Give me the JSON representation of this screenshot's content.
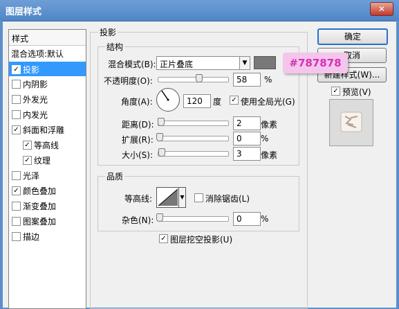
{
  "window": {
    "title": "图层样式",
    "close_glyph": "✕"
  },
  "colors": {
    "shadow_swatch": "#787878",
    "tooltip_text": "#787878"
  },
  "sidebar": {
    "header": "样式",
    "items": [
      {
        "label": "混合选项:默认",
        "checkbox": false
      },
      {
        "label": "投影",
        "checkbox": true,
        "checked": true,
        "selected": true
      },
      {
        "label": "内阴影",
        "checkbox": true,
        "checked": false
      },
      {
        "label": "外发光",
        "checkbox": true,
        "checked": false
      },
      {
        "label": "内发光",
        "checkbox": true,
        "checked": false
      },
      {
        "label": "斜面和浮雕",
        "checkbox": true,
        "checked": true
      },
      {
        "label": "等高线",
        "checkbox": true,
        "checked": true,
        "indent": true
      },
      {
        "label": "纹理",
        "checkbox": true,
        "checked": true,
        "indent": true
      },
      {
        "label": "光泽",
        "checkbox": true,
        "checked": false
      },
      {
        "label": "颜色叠加",
        "checkbox": true,
        "checked": true
      },
      {
        "label": "渐变叠加",
        "checkbox": true,
        "checked": false
      },
      {
        "label": "图案叠加",
        "checkbox": true,
        "checked": false
      },
      {
        "label": "描边",
        "checkbox": true,
        "checked": false
      }
    ]
  },
  "drop_shadow": {
    "section_title": "投影",
    "structure_title": "结构",
    "blend_mode_label": "混合模式(B):",
    "blend_mode_value": "正片叠底",
    "opacity_label": "不透明度(O):",
    "opacity_value": "58",
    "opacity_unit": "%",
    "opacity_level": 0.58,
    "angle_label": "角度(A):",
    "angle_value": "120",
    "angle_unit": "度",
    "global_light_label": "使用全局光(G)",
    "global_light_checked": true,
    "distance_label": "距离(D):",
    "distance_value": "2",
    "distance_unit": "像素",
    "spread_label": "扩展(R):",
    "spread_value": "0",
    "spread_unit": "%",
    "size_label": "大小(S):",
    "size_value": "3",
    "size_unit": "像素",
    "quality_title": "品质",
    "contour_label": "等高线:",
    "antialias_label": "消除锯齿(L)",
    "antialias_checked": false,
    "noise_label": "杂色(N):",
    "noise_value": "0",
    "noise_unit": "%",
    "knockout_label": "图层挖空投影(U)",
    "knockout_checked": true
  },
  "buttons": {
    "ok": "确定",
    "cancel": "取消",
    "new_style": "新建样式(W)...",
    "preview": "预览(V)",
    "preview_checked": true
  },
  "tooltip": "#787878",
  "checkmark": "✓",
  "dropdown_glyph": "▼"
}
